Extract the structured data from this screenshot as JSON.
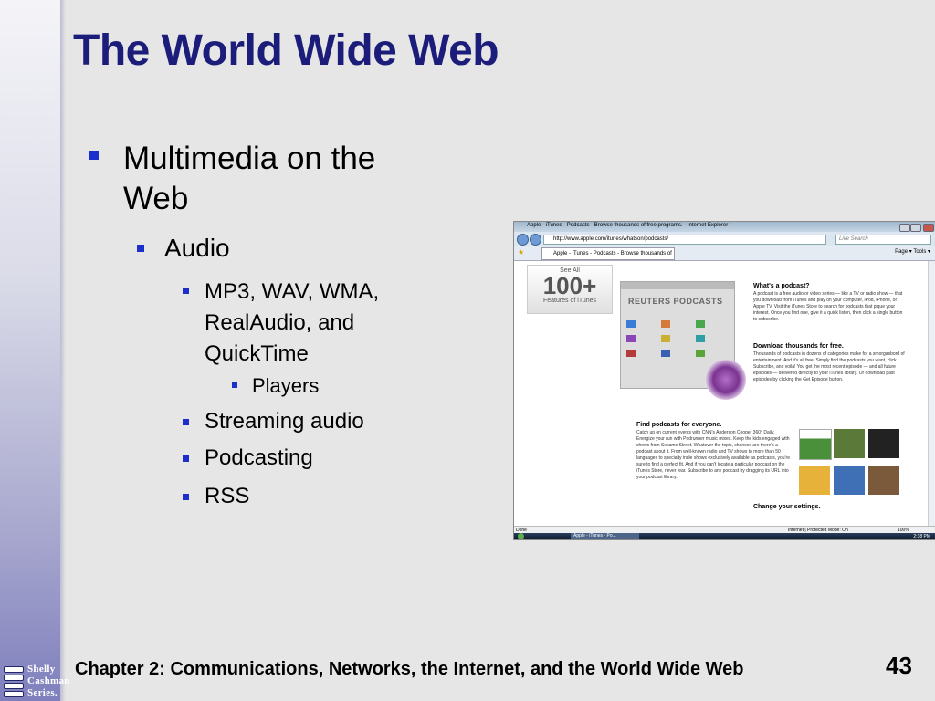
{
  "slide": {
    "title": "The World Wide Web",
    "footer": "Chapter 2: Communications, Networks, the Internet, and the World Wide Web",
    "page_number": "43",
    "logo_lines": [
      "Shelly",
      "Cashman",
      "Series."
    ]
  },
  "bullets": {
    "l1_line1": "Multimedia on the",
    "l1_line2": "Web",
    "audio": "Audio",
    "formats_line1": "MP3, WAV, WMA,",
    "formats_line2": "RealAudio, and",
    "formats_line3": "QuickTime",
    "players": "Players",
    "streaming": "Streaming audio",
    "podcasting": "Podcasting",
    "rss": "RSS"
  },
  "screenshot": {
    "window_title": "Apple - iTunes - Podcasts - Browse thousands of free programs. - Internet Explorer",
    "url": "http://www.apple.com/itunes/whatson/podcasts/",
    "live_search": "Live Search",
    "tab_title": "Apple - iTunes - Podcasts - Browse thousands of ...",
    "tools_text": "Page ▾  Tools ▾",
    "see_all": "See All",
    "count": "100+",
    "features": "Features of iTunes",
    "reuters": "REUTERS PODCASTS",
    "what_heading": "What's a podcast?",
    "what_text": "A podcast is a free audio or video series — like a TV or radio show — that you download from iTunes and play on your computer, iPod, iPhone, or Apple TV. Visit the iTunes Store to search for podcasts that pique your interest. Once you find one, give it a quick listen, then click a single button to subscribe.",
    "download_heading": "Download thousands for free.",
    "download_text": "Thousands of podcasts in dozens of categories make for a smorgasbord of entertainment. And it's all free. Simply find the podcasts you want, click Subscribe, and voilà! You get the most recent episode — and all future episodes — delivered directly to your iTunes library. Or download past episodes by clicking the Get Episode button.",
    "find_heading": "Find podcasts for everyone.",
    "find_text": "Catch up on current events with CNN's Anderson Cooper 360° Daily. Energize your run with Podrunner music mixes. Keep the kids engaged with shows from Sesame Street. Whatever the topic, chances are there's a podcast about it. From well-known radio and TV shows to more than 50 languages to specialty indie shows exclusively available as podcasts, you're sure to find a perfect fit. And if you can't locate a particular podcast on the iTunes Store, never fear. Subscribe to any podcast by dragging its URL into your podcast library.",
    "settings_heading": "Change your settings.",
    "status_left": "Done",
    "status_zone": "Internet | Protected Mode: On",
    "zoom": "100%",
    "taskbar_item": "Apple - iTunes - Po...",
    "clock": "2:38 PM"
  }
}
